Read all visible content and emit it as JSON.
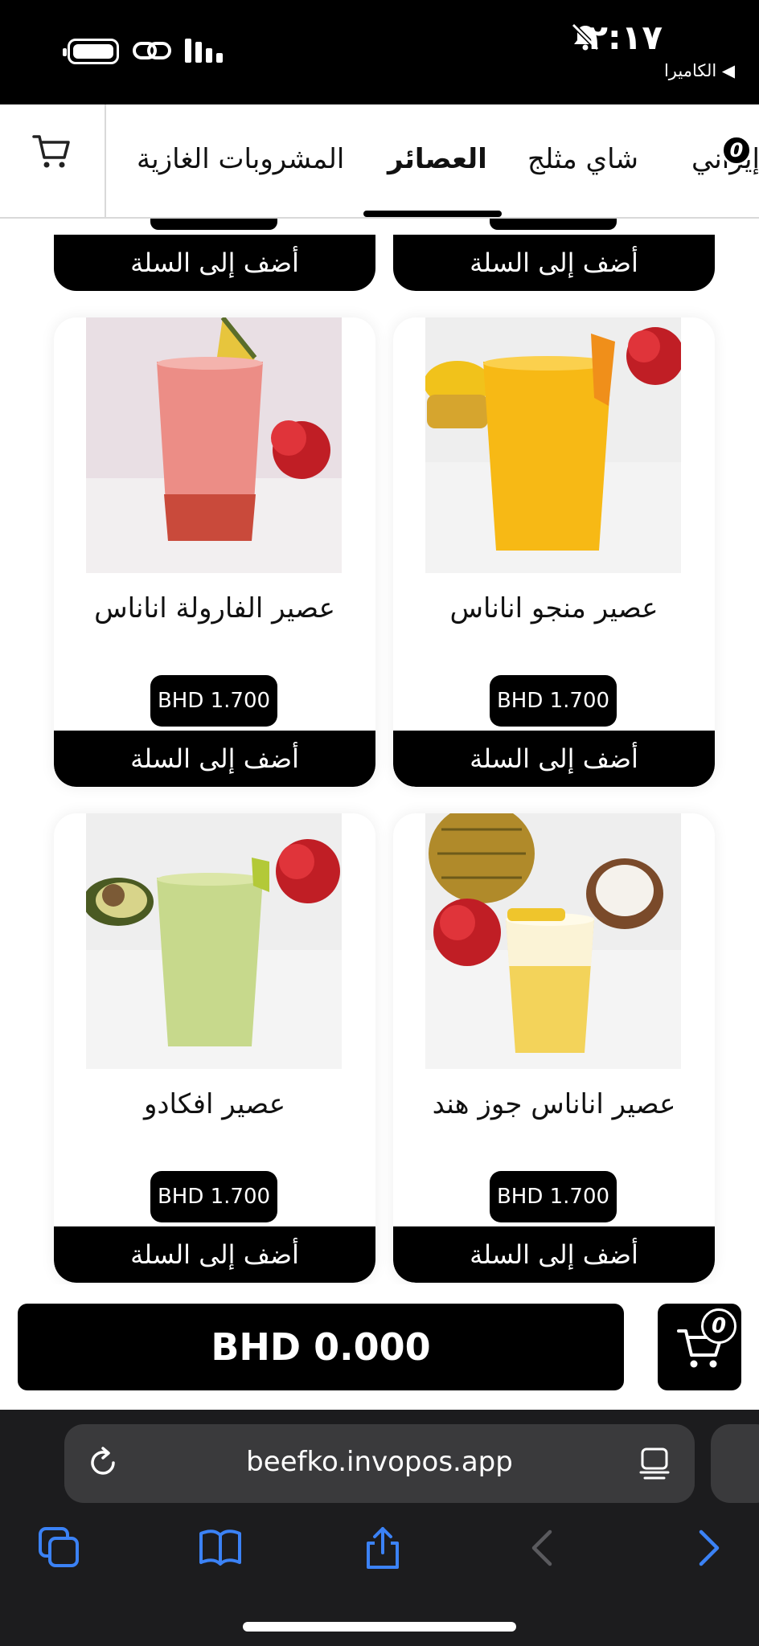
{
  "status_bar": {
    "time": "٢:١٧",
    "back_label": "◀ الكاميرا"
  },
  "category_nav": {
    "tabs": [
      {
        "label": "المشروبات الغازية",
        "active": false
      },
      {
        "label": "العصائر",
        "active": true
      },
      {
        "label": "شاي مثلج",
        "active": false
      },
      {
        "label": "إيراني",
        "active": false
      }
    ],
    "cart_count": "0"
  },
  "products": {
    "add_label": "أضف إلى السلة",
    "items": [
      {
        "name": "عصير الفارولة اناناس",
        "price": "BHD 1.700"
      },
      {
        "name": "عصير منجو اناناس",
        "price": "BHD 1.700"
      },
      {
        "name": "عصير افكادو",
        "price": "BHD 1.700"
      },
      {
        "name": "عصير اناناس جوز هند",
        "price": "BHD 1.700"
      }
    ]
  },
  "checkout": {
    "total": "BHD 0.000",
    "cart_count": "0"
  },
  "browser": {
    "url": "beefko.invopos.app"
  },
  "colors": {
    "accent": "#000000",
    "browser_bg": "#1c1c1e",
    "browser_icon": "#3b82f6"
  }
}
